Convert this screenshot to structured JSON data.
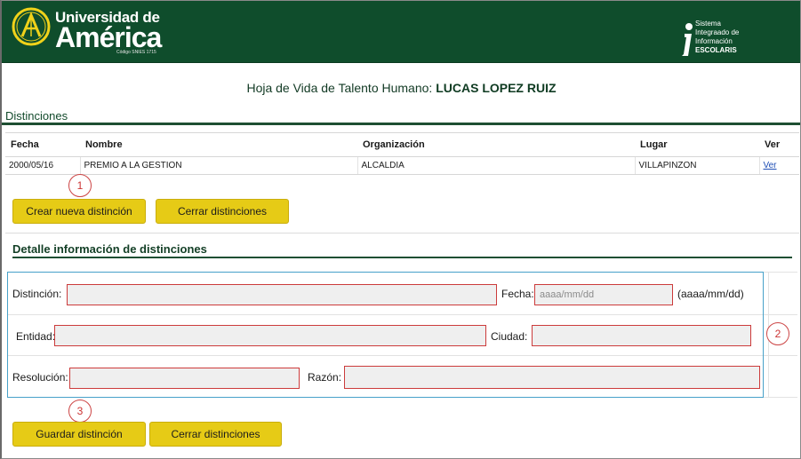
{
  "header": {
    "university_line1": "Universidad de",
    "university_line2": "América",
    "university_code": "Código SNIES 1715",
    "system_lines": [
      "Sistema",
      "Integraado de",
      "Información",
      "ESCOLARIS"
    ]
  },
  "page": {
    "title_prefix": "Hoja de Vida de Talento Humano: ",
    "person_name": "LUCAS LOPEZ RUIZ",
    "section_title": "Distinciones"
  },
  "table": {
    "headers": [
      "Fecha",
      "Nombre",
      "Organización",
      "Lugar",
      "Ver"
    ],
    "rows": [
      {
        "fecha": "2000/05/16",
        "nombre": "PREMIO A LA GESTION",
        "organizacion": "ALCALDIA",
        "lugar": "VILLAPINZON",
        "ver": "Ver"
      }
    ]
  },
  "actions_top": {
    "create_label": "Crear nueva distinción",
    "close_label": "Cerrar distinciones"
  },
  "markers": [
    "1",
    "2",
    "3"
  ],
  "detail": {
    "title": "Detalle información de distinciones",
    "distincion_label": "Distinción:",
    "fecha_label": "Fecha:",
    "fecha_placeholder": "aaaa/mm/dd",
    "fecha_format": "(aaaa/mm/dd)",
    "entidad_label": "Entidad:",
    "ciudad_label": "Ciudad:",
    "resolucion_label": "Resolución:",
    "razon_label": "Razón:"
  },
  "actions_bottom": {
    "save_label": "Guardar distinción",
    "close_label": "Cerrar distinciones"
  },
  "colors": {
    "header_green": "#0f4d2c",
    "button_yellow": "#e6cb16",
    "field_border_red": "#cc3b3b",
    "form_border_blue": "#47a1c9"
  },
  "icons": [
    "university-logo-icon",
    "info-i-icon"
  ]
}
